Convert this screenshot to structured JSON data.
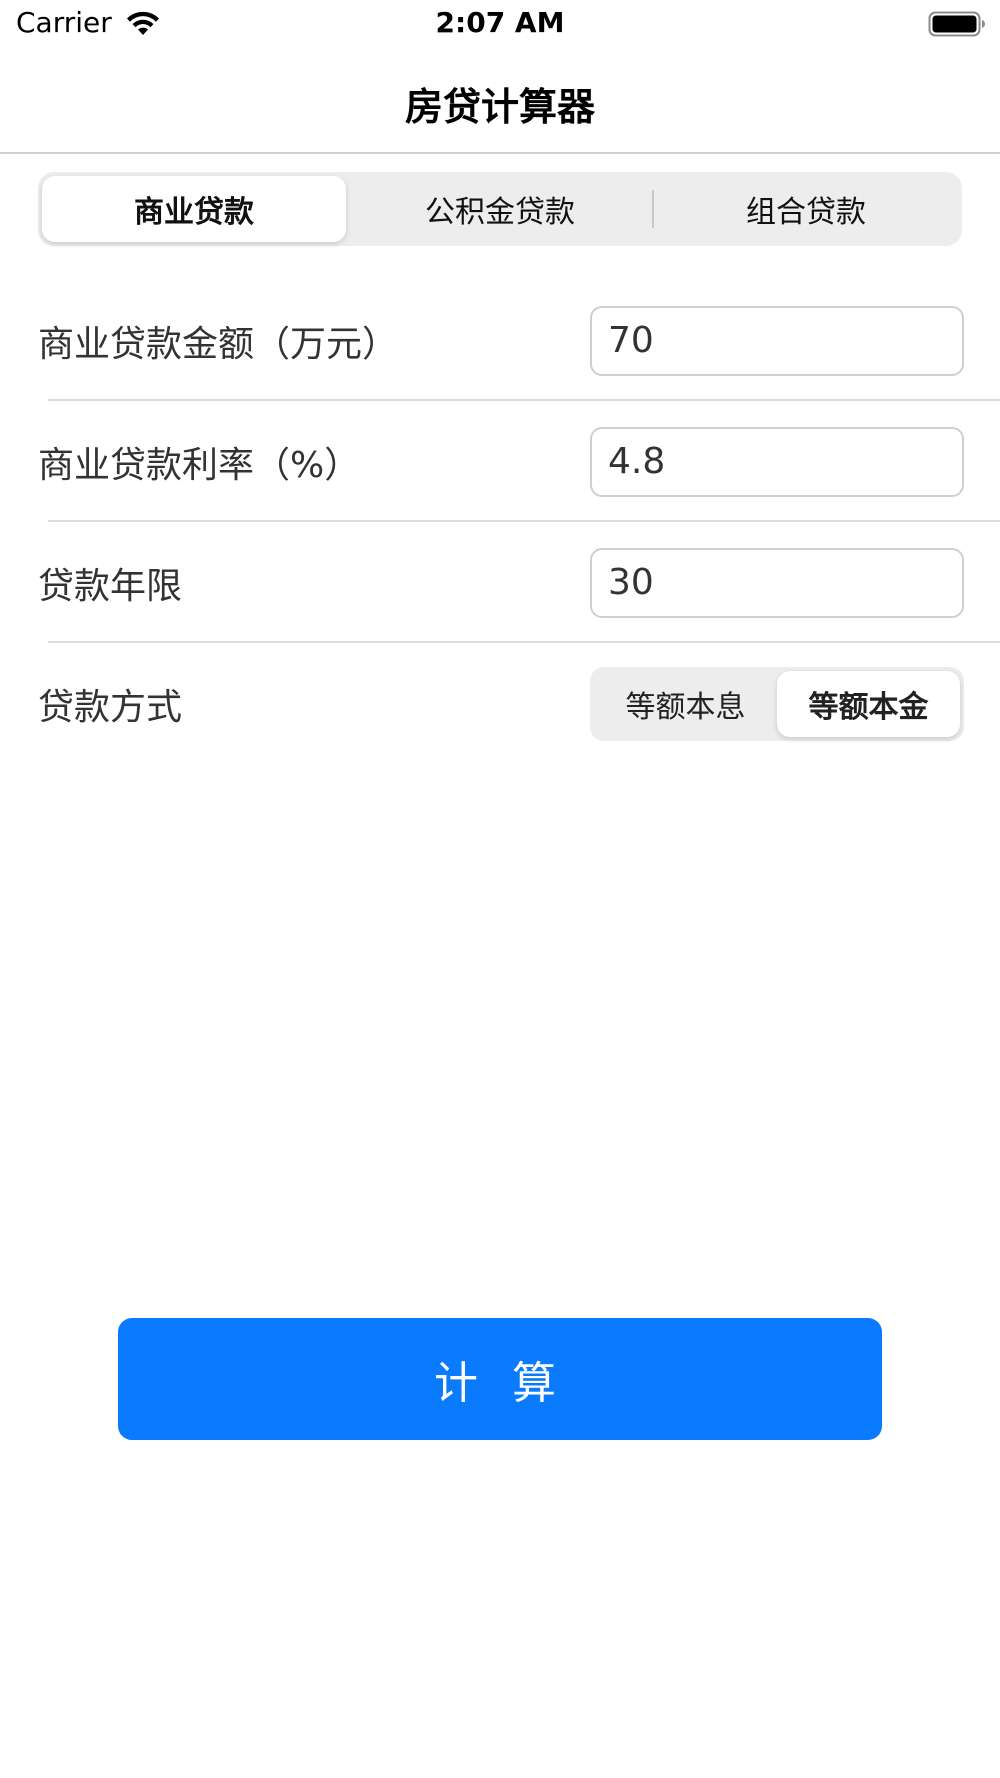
{
  "status_bar": {
    "carrier": "Carrier",
    "time": "2:07 AM",
    "wifi_icon": "wifi-icon",
    "battery_icon": "battery-icon"
  },
  "nav": {
    "title": "房贷计算器"
  },
  "loan_type": {
    "options": [
      "商业贷款",
      "公积金贷款",
      "组合贷款"
    ],
    "selected": "商业贷款"
  },
  "form": {
    "amount": {
      "label": "商业贷款金额（万元）",
      "value": "70"
    },
    "rate": {
      "label": "商业贷款利率（%）",
      "value": "4.8"
    },
    "years": {
      "label": "贷款年限",
      "value": "30"
    },
    "method": {
      "label": "贷款方式",
      "options": [
        "等额本息",
        "等额本金"
      ],
      "selected": "等额本金"
    }
  },
  "calculate_button": {
    "label": "计 算"
  },
  "colors": {
    "accent": "#0a7aff",
    "segment_bg": "#ededed",
    "divider": "#dcdcdc"
  }
}
